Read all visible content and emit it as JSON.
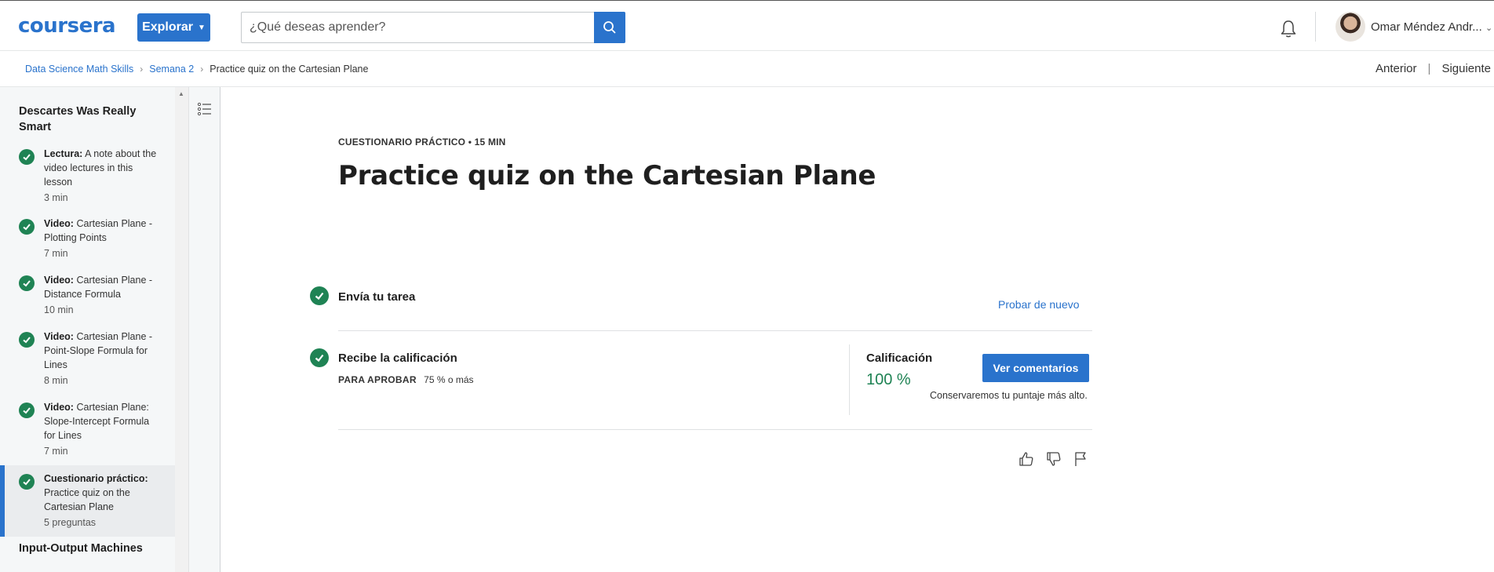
{
  "header": {
    "logo": "coursera",
    "explore_label": "Explorar",
    "search_placeholder": "¿Qué deseas aprender?",
    "user_name": "Omar Méndez Andr..."
  },
  "breadcrumb": {
    "items": [
      "Data Science Math Skills",
      "Semana 2"
    ],
    "current": "Practice quiz on the Cartesian Plane",
    "prev_label": "Anterior",
    "next_label": "Siguiente"
  },
  "sidebar": {
    "section_title": "Descartes Was Really Smart",
    "items": [
      {
        "type": "Lectura:",
        "title": "A note about the video lectures in this lesson",
        "duration": "3 min"
      },
      {
        "type": "Video:",
        "title": "Cartesian Plane - Plotting Points",
        "duration": "7 min"
      },
      {
        "type": "Video:",
        "title": "Cartesian Plane - Distance Formula",
        "duration": "10 min"
      },
      {
        "type": "Video:",
        "title": "Cartesian Plane - Point-Slope Formula for Lines",
        "duration": "8 min"
      },
      {
        "type": "Video:",
        "title": "Cartesian Plane: Slope-Intercept Formula for Lines",
        "duration": "7 min"
      },
      {
        "type": "Cuestionario práctico:",
        "title": "Practice quiz on the Cartesian Plane",
        "duration": "5 preguntas"
      }
    ],
    "next_section_title": "Input-Output Machines"
  },
  "main": {
    "kicker": "CUESTIONARIO PRÁCTICO • 15 MIN",
    "title": "Practice quiz on the Cartesian Plane",
    "step1_label": "Envía tu tarea",
    "retry_label": "Probar de nuevo",
    "step2_label": "Recibe la calificación",
    "pass_label": "PARA APROBAR",
    "pass_value": "75 % o más",
    "grade_label": "Calificación",
    "grade_value": "100 %",
    "feedback_button": "Ver comentarios",
    "keep_note": "Conservaremos tu puntaje más alto."
  },
  "colors": {
    "brand_blue": "#2a73cc",
    "success_green": "#1f8354"
  }
}
